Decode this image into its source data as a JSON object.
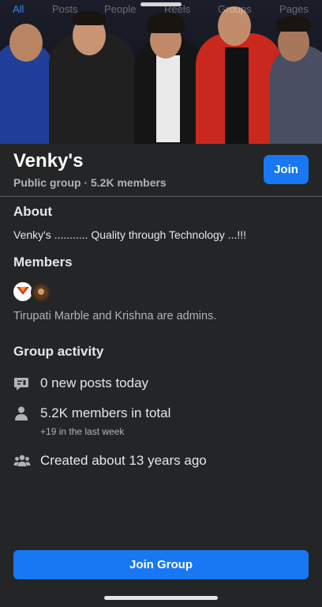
{
  "tabs": [
    "All",
    "Posts",
    "People",
    "Reels",
    "Groups",
    "Pages"
  ],
  "group": {
    "name": "Venky's",
    "meta": "Public group · 5.2K members",
    "join_label": "Join"
  },
  "about": {
    "heading": "About",
    "description": "Venky's ...........  Quality through Technology ...!!!"
  },
  "members": {
    "heading": "Members",
    "admins_text": "Tirupati Marble and Krishna are admins."
  },
  "activity": {
    "heading": "Group activity",
    "items": [
      {
        "icon": "chat-bubble-icon",
        "text": "0 new posts today",
        "sub": ""
      },
      {
        "icon": "person-icon",
        "text": "5.2K members in total",
        "sub": "+19 in the last week"
      },
      {
        "icon": "people-group-icon",
        "text": "Created about 13 years ago",
        "sub": ""
      }
    ]
  },
  "footer": {
    "join_group_label": "Join Group"
  },
  "colors": {
    "accent": "#1877f2",
    "background": "#242526"
  }
}
